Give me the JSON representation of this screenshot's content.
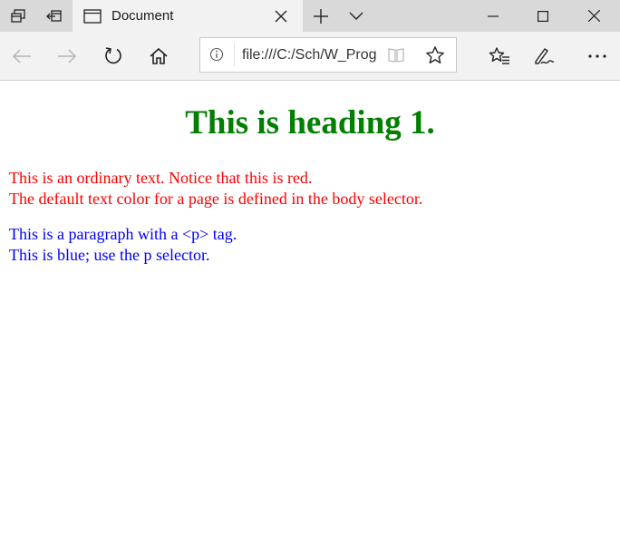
{
  "browser": {
    "tab": {
      "title": "Document"
    },
    "address_bar": {
      "url": "file:///C:/Sch/W_Prog"
    },
    "icons": {
      "set_aside": "tabs-aside-icon",
      "restore": "tabs-restore-icon",
      "new_tab": "plus-icon",
      "tab_list": "chevron-down-icon",
      "minimize": "minimize-icon",
      "maximize": "maximize-icon",
      "close": "close-icon",
      "back": "back-arrow-icon",
      "forward": "forward-arrow-icon",
      "refresh": "refresh-icon",
      "home": "home-icon",
      "favorites_hub": "favorites-hub-icon",
      "pen": "pen-icon",
      "more": "more-icon"
    }
  },
  "page": {
    "heading": "This is heading 1.",
    "body_text_line1": "This is an ordinary text. Notice that this is red.",
    "body_text_line2": "The default text color for a page is defined in the body selector.",
    "paragraph_line1": "This is a paragraph with a <p> tag.",
    "paragraph_line2": "This is blue; use the p selector."
  },
  "colors": {
    "heading": "#008000",
    "body_text": "#ff0000",
    "paragraph": "#0000ff"
  }
}
